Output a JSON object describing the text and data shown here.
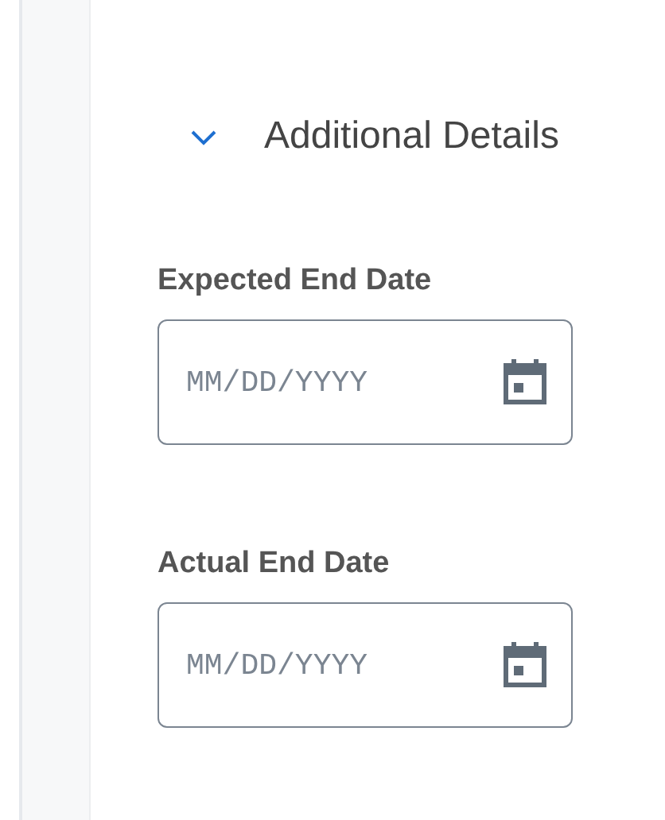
{
  "section": {
    "title": "Additional Details",
    "expanded": true
  },
  "fields": [
    {
      "label": "Expected End Date",
      "placeholder": "MM/DD/YYYY"
    },
    {
      "label": "Actual End Date",
      "placeholder": "MM/DD/YYYY"
    }
  ]
}
